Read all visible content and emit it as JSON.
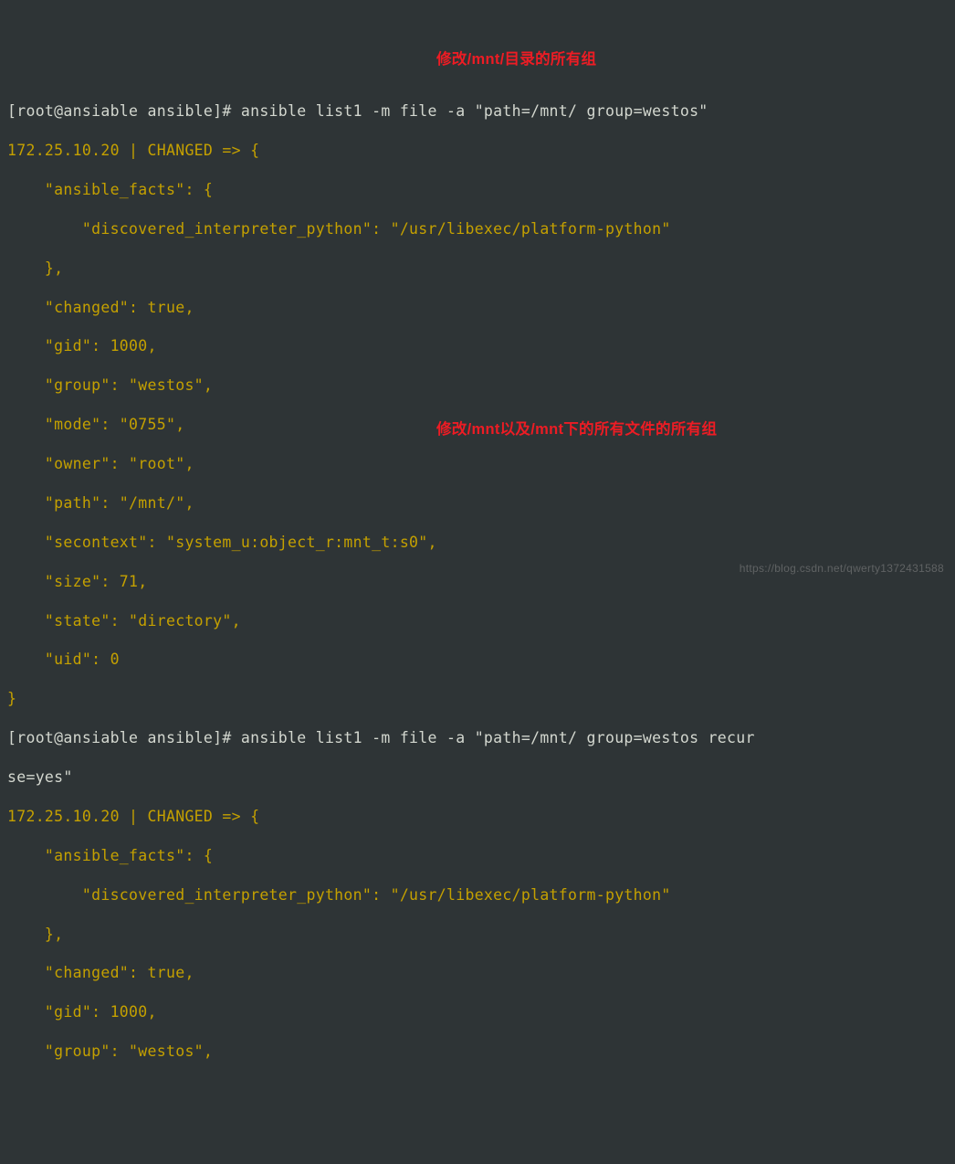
{
  "lines": {
    "l1": "[root@ansiable ansible]# ansible list1 -m file -a \"path=/mnt/ group=westos\"",
    "l2": "172.25.10.20 | CHANGED => {",
    "l3": "    \"ansible_facts\": {",
    "l4": "        \"discovered_interpreter_python\": \"/usr/libexec/platform-python\"",
    "l5": "    },",
    "l6": "    \"changed\": true,",
    "l7": "    \"gid\": 1000,",
    "l8": "    \"group\": \"westos\",",
    "l9": "    \"mode\": \"0755\",",
    "l10": "    \"owner\": \"root\",",
    "l11": "    \"path\": \"/mnt/\",",
    "l12": "    \"secontext\": \"system_u:object_r:mnt_t:s0\",",
    "l13": "    \"size\": 71,",
    "l14": "    \"state\": \"directory\",",
    "l15": "    \"uid\": 0",
    "l16": "}",
    "l17a": "[root@ansiable ansible]# ansible list1 -m file -a \"path=/mnt/ group=westos recur",
    "l17b": "se=yes\"",
    "l18": "172.25.10.20 | CHANGED => {",
    "l19": "    \"ansible_facts\": {",
    "l20": "        \"discovered_interpreter_python\": \"/usr/libexec/platform-python\"",
    "l21": "    },",
    "l22": "    \"changed\": true,",
    "l23": "    \"gid\": 1000,",
    "l24": "    \"group\": \"westos\","
  },
  "annotations": {
    "a1": "修改/mnt/目录的所有组",
    "a2": "修改/mnt以及/mnt下的所有文件的所有组"
  },
  "watermark": "https://blog.csdn.net/qwerty1372431588"
}
